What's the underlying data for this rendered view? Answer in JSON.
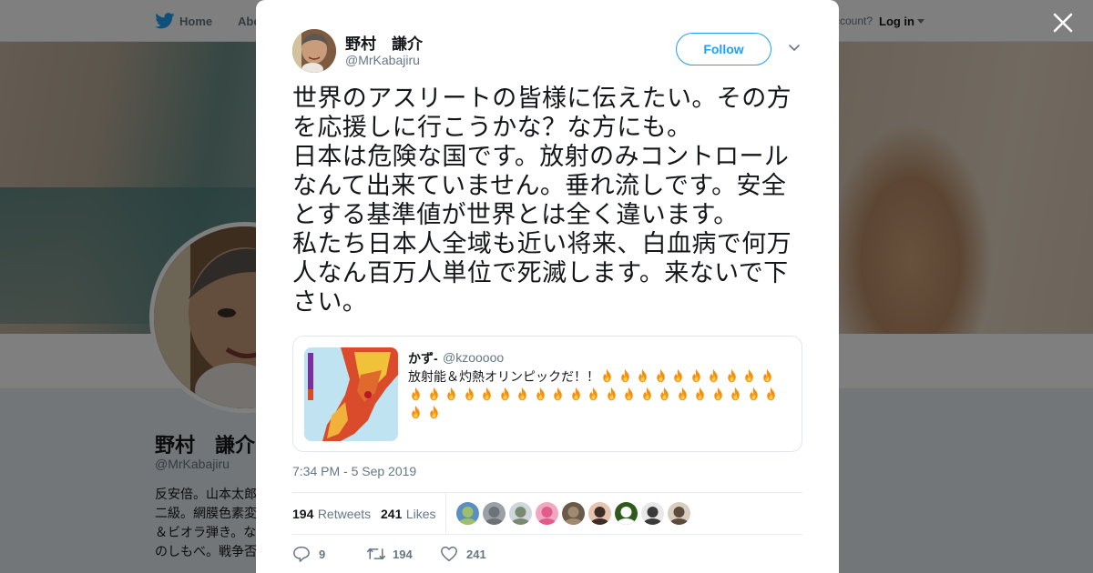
{
  "nav": {
    "home": "Home",
    "about": "Abo",
    "account_prompt": "ccount?",
    "login": "Log in"
  },
  "profile": {
    "name": "野村　謙介",
    "handle": "@MrKabajiru",
    "bio": "反安倍。山本太郎\n二級。網膜色素変\n＆ビオラ弾き。な\nのしもべ。戦争否"
  },
  "tweet": {
    "author_name": "野村　謙介",
    "author_handle": "@MrKabajiru",
    "follow_label": "Follow",
    "text": "世界のアスリートの皆様に伝えたい。その方を応援しに行こうかな？な方にも。\n日本は危険な国です。放射のみコントロールなんて出来ていません。垂れ流しです。安全とする基準値が世界とは全く違います。\n私たち日本人全域も近い将来、白血病で何万人なん百万人単位で死滅します。来ないで下さい。",
    "timestamp": "7:34 PM - 5 Sep 2019",
    "retweets": "194",
    "retweets_label": "Retweets",
    "likes": "241",
    "likes_label": "Likes",
    "replies_count": "9",
    "retweet_count": "194",
    "like_count": "241"
  },
  "quote": {
    "name": "かず-",
    "handle": "@kzooooo",
    "text": "放射能＆灼熱オリンピックだ！！",
    "fire_rows": [
      10,
      21,
      2
    ]
  },
  "likers": [
    {
      "icon": "liker-avatar-1"
    },
    {
      "icon": "liker-avatar-2"
    },
    {
      "icon": "liker-avatar-3"
    },
    {
      "icon": "liker-avatar-4"
    },
    {
      "icon": "liker-avatar-5"
    },
    {
      "icon": "liker-avatar-6"
    },
    {
      "icon": "liker-avatar-7"
    },
    {
      "icon": "liker-avatar-8"
    },
    {
      "icon": "liker-avatar-9"
    }
  ],
  "colors": {
    "brand": "#1da1f2",
    "text": "#14171a",
    "muted": "#657786",
    "border": "#e6ecf0"
  },
  "icons": {
    "logo": "twitter-bird-icon",
    "close": "close-icon",
    "caret": "chevron-down-icon",
    "reply": "reply-icon",
    "retweet": "retweet-icon",
    "like": "heart-icon",
    "fire": "fire-emoji-icon"
  }
}
